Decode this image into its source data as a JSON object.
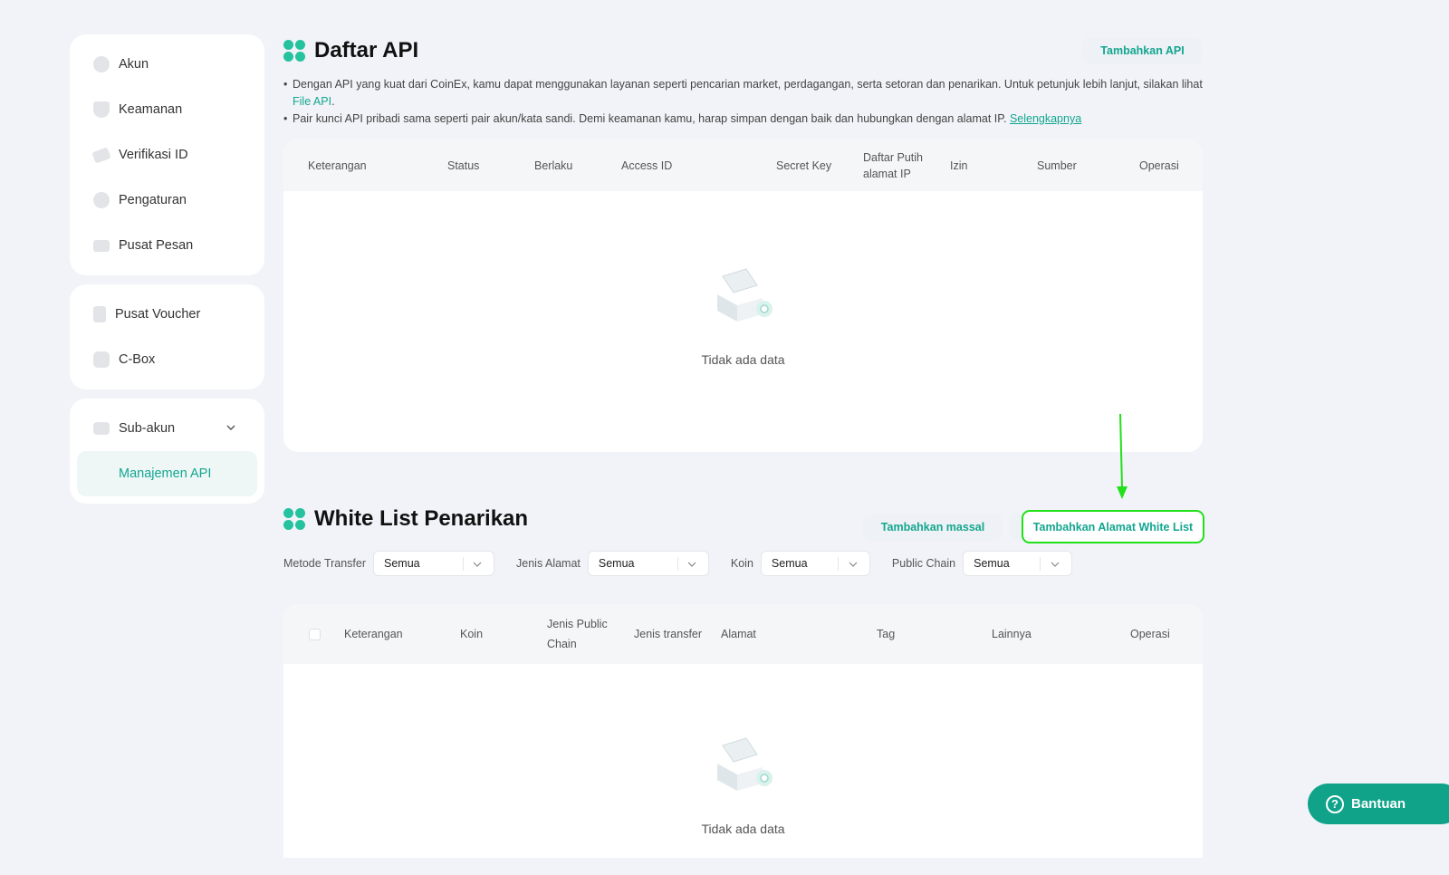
{
  "sidebar": {
    "group1": [
      {
        "label": "Akun",
        "icon": "pie-chart-icon"
      },
      {
        "label": "Keamanan",
        "icon": "shield-icon"
      },
      {
        "label": "Verifikasi ID",
        "icon": "id-card-icon"
      },
      {
        "label": "Pengaturan",
        "icon": "gear-icon"
      },
      {
        "label": "Pusat Pesan",
        "icon": "message-icon"
      }
    ],
    "group2": [
      {
        "label": "Pusat Voucher",
        "icon": "voucher-icon"
      },
      {
        "label": "C-Box",
        "icon": "box-icon"
      }
    ],
    "group3": [
      {
        "label": "Sub-akun",
        "icon": "sub-account-icon"
      },
      {
        "label": "Manajemen API",
        "icon": "api-icon"
      }
    ]
  },
  "api_section": {
    "title": "Daftar API",
    "add_button": "Tambahkan API",
    "note1": "Dengan API yang kuat dari CoinEx, kamu dapat menggunakan layanan seperti pencarian market, perdagangan, serta setoran dan penarikan. Untuk petunjuk lebih lanjut, silakan lihat",
    "note1_link": "File API",
    "note1_end": ".",
    "note2": "Pair kunci API pribadi sama seperti pair akun/kata sandi. Demi keamanan kamu, harap simpan dengan baik dan hubungkan dengan alamat IP.",
    "note2_link": "Selengkapnya",
    "columns": [
      "Keterangan",
      "Status",
      "Berlaku",
      "Access ID",
      "Secret Key",
      "Daftar Putih alamat IP",
      "Izin",
      "Sumber",
      "Operasi"
    ],
    "empty_text": "Tidak ada data"
  },
  "whitelist_section": {
    "title": "White List Penarikan",
    "bulk_button": "Tambahkan massal",
    "add_button": "Tambahkan Alamat White List",
    "filters": [
      {
        "label": "Metode Transfer",
        "value": "Semua"
      },
      {
        "label": "Jenis Alamat",
        "value": "Semua"
      },
      {
        "label": "Koin",
        "value": "Semua"
      },
      {
        "label": "Public Chain",
        "value": "Semua"
      }
    ],
    "columns": [
      "Keterangan",
      "Koin",
      "Jenis Public Chain",
      "Jenis transfer",
      "Alamat",
      "Tag",
      "Lainnya",
      "Operasi"
    ],
    "empty_text": "Tidak ada data"
  },
  "help": {
    "label": "Bantuan"
  },
  "colors": {
    "accent": "#13a690",
    "highlight": "#22e01a",
    "background": "#f1f3f8"
  }
}
